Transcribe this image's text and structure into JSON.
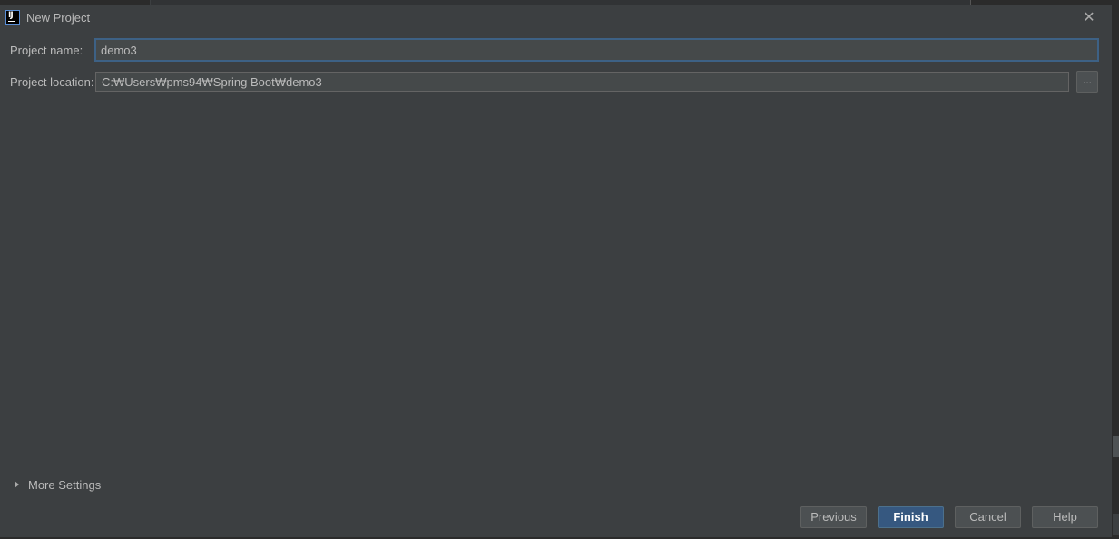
{
  "window": {
    "title": "New Project",
    "icon_label": "IJ"
  },
  "form": {
    "project_name_label": "Project name:",
    "project_name_value": "demo3",
    "project_location_label": "Project location:",
    "project_location_value": "C:₩Users₩pms94₩Spring Boot₩demo3",
    "browse_label": "..."
  },
  "more_settings": {
    "label": "More Settings"
  },
  "buttons": {
    "previous": "Previous",
    "finish": "Finish",
    "cancel": "Cancel",
    "help": "Help"
  },
  "colors": {
    "dialog_bg": "#3c3f41",
    "input_bg": "#45494a",
    "focus_border": "#3d6185",
    "primary_button": "#365880"
  }
}
